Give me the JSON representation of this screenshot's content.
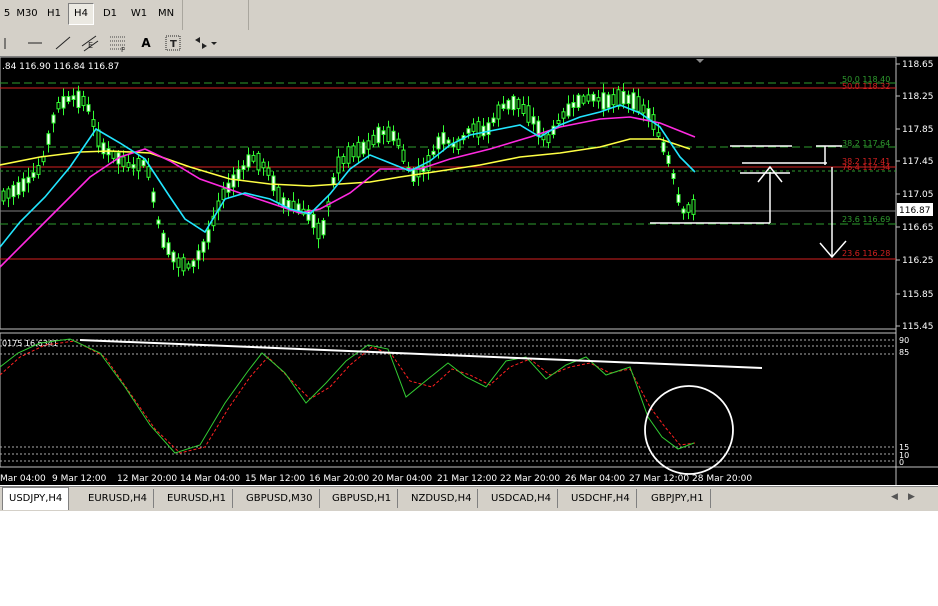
{
  "toolbar": {
    "timeframes": [
      {
        "label": "5",
        "active": false
      },
      {
        "label": "M30",
        "active": false
      },
      {
        "label": "H1",
        "active": false
      },
      {
        "label": "H4",
        "active": true
      },
      {
        "label": "D1",
        "active": false
      },
      {
        "label": "W1",
        "active": false
      },
      {
        "label": "MN",
        "active": false
      }
    ],
    "tools": [
      {
        "icon": "vertical-line-icon"
      },
      {
        "icon": "horizontal-line-icon"
      },
      {
        "icon": "trendline-icon"
      },
      {
        "icon": "equidistant-channel-icon",
        "glyph": "E"
      },
      {
        "icon": "fibonacci-icon",
        "glyph": "F"
      },
      {
        "icon": "text-icon",
        "label": "A"
      },
      {
        "icon": "text-label-icon",
        "label": "T"
      },
      {
        "icon": "arrows-icon"
      },
      {
        "icon": "dropdown-icon"
      }
    ]
  },
  "chart": {
    "ohlc_label": ".84 116.90 116.84 116.87",
    "current_price": "116.87",
    "price_axis": [
      "118.65",
      "118.25",
      "117.85",
      "117.45",
      "117.05",
      "116.65",
      "116.25",
      "115.85",
      "115.45"
    ],
    "fib_levels": [
      {
        "pct": "50.0",
        "price": "118.40",
        "color": "#2e9b2e"
      },
      {
        "pct": "50.0",
        "price": "118.32",
        "color": "#d42020"
      },
      {
        "pct": "38.2",
        "price": "117.64",
        "color": "#2e9b2e"
      },
      {
        "pct": "38.2",
        "price": "117.41",
        "color": "#d42020"
      },
      {
        "pct": "76.4",
        "price": "117.34",
        "color": "#d42020"
      },
      {
        "pct": "23.6",
        "price": "116.69",
        "color": "#2e9b2e"
      },
      {
        "pct": "23.6",
        "price": "116.28",
        "color": "#d42020"
      }
    ],
    "candle_color": "#33ff33",
    "ma_colors": {
      "cyan": "#22e5ff",
      "magenta": "#ff2ae0",
      "yellow": "#ffff44"
    }
  },
  "oscillator": {
    "label": "0175 16.6341",
    "levels": [
      "90",
      "85",
      "15",
      "10",
      "0"
    ],
    "main_color": "#33cc33",
    "signal_color": "#ff2020"
  },
  "time_axis": [
    "Mar 04:00",
    "9 Mar 12:00",
    "12 Mar 20:00",
    "14 Mar 04:00",
    "15 Mar 12:00",
    "16 Mar 20:00",
    "20 Mar 04:00",
    "21 Mar 12:00",
    "22 Mar 20:00",
    "26 Mar 04:00",
    "27 Mar 12:00",
    "28 Mar 20:00"
  ],
  "tabs": [
    {
      "label": "USDJPY,H4",
      "active": true
    },
    {
      "label": "EURUSD,H4",
      "active": false
    },
    {
      "label": "EURUSD,H1",
      "active": false
    },
    {
      "label": "GBPUSD,M30",
      "active": false
    },
    {
      "label": "GBPUSD,H1",
      "active": false
    },
    {
      "label": "NZDUSD,H4",
      "active": false
    },
    {
      "label": "USDCAD,H4",
      "active": false
    },
    {
      "label": "USDCHF,H4",
      "active": false
    },
    {
      "label": "GBPJPY,H1",
      "active": false
    }
  ]
}
